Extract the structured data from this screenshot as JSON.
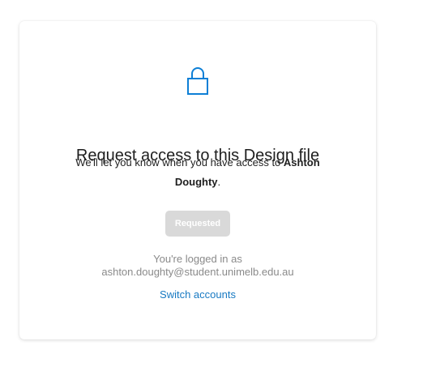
{
  "card": {
    "icon": "lock-icon",
    "title": "Request access to this Design file",
    "message_prefix": "We'll let you know when you have access to ",
    "owner_name": "Ashton Doughty",
    "message_suffix": ".",
    "request_button_label": "Requested",
    "logged_in_label": "You're logged in as",
    "user_email": "ashton.doughty@student.unimelb.edu.au",
    "switch_accounts_label": "Switch accounts"
  },
  "colors": {
    "accent": "#0d7fd6",
    "link": "#1779c2",
    "button_disabled_bg": "#d9d9d9",
    "muted_text": "#8a8a8a",
    "text": "#1e1e1e"
  }
}
